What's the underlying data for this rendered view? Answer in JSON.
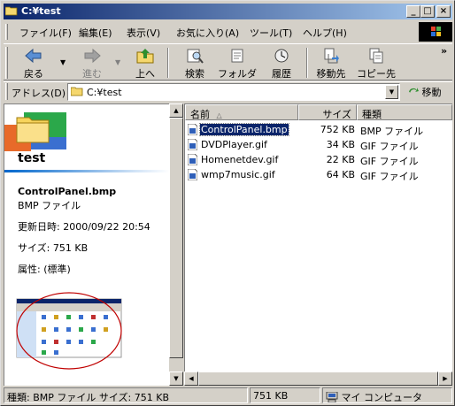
{
  "window": {
    "title": "C:¥test"
  },
  "menu": {
    "items": [
      "ファイル(F)",
      "編集(E)",
      "表示(V)",
      "お気に入り(A)",
      "ツール(T)",
      "ヘルプ(H)"
    ]
  },
  "toolbar": {
    "back": "戻る",
    "forward": "進む",
    "up": "上へ",
    "search": "検索",
    "folders": "フォルダ",
    "history": "履歴",
    "move_to": "移動先",
    "copy_to": "コピー先",
    "more": "»"
  },
  "address": {
    "label": "アドレス(D)",
    "value": "C:¥test",
    "go": "移動"
  },
  "left_pane": {
    "folder_name": "test",
    "file_name": "ControlPanel.bmp",
    "file_type": "BMP ファイル",
    "modified": "更新日時: 2000/09/22 20:54",
    "size": "サイズ: 751 KB",
    "attributes": "属性: (標準)"
  },
  "columns": {
    "name": "名前",
    "sort_indicator": "△",
    "size": "サイズ",
    "type": "種類"
  },
  "files": [
    {
      "name": "ControlPanel.bmp",
      "size": "752 KB",
      "type": "BMP ファイル",
      "selected": true
    },
    {
      "name": "DVDPlayer.gif",
      "size": "34 KB",
      "type": "GIF ファイル",
      "selected": false
    },
    {
      "name": "Homenetdev.gif",
      "size": "22 KB",
      "type": "GIF ファイル",
      "selected": false
    },
    {
      "name": "wmp7music.gif",
      "size": "64 KB",
      "type": "GIF ファイル",
      "selected": false
    }
  ],
  "status": {
    "info": "種類: BMP ファイル サイズ: 751 KB",
    "size": "751 KB",
    "zone": "マイ コンピュータ"
  },
  "colors": {
    "title_start": "#0a246a",
    "title_end": "#a6caf0",
    "selection": "#0a246a",
    "face": "#d4d0c8"
  }
}
